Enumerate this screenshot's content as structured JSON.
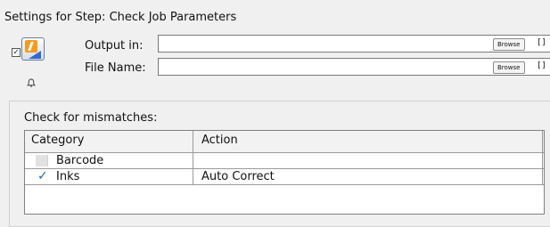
{
  "title": "Settings for Step: Check Job Parameters",
  "output_row": {
    "label": "Output in:",
    "value": "",
    "browse_label": "Browse",
    "bracket": "[]"
  },
  "file_row": {
    "label": "File Name:",
    "value": "",
    "browse_label": "Browse",
    "bracket": "[]"
  },
  "step_icon": {
    "checkbox_mark": "✓",
    "icon": "check-job-parameters-icon"
  },
  "mismatch": {
    "label": "Check for mismatches:",
    "columns": [
      "Category",
      "Action"
    ],
    "rows": [
      {
        "category": "Barcode",
        "action": "",
        "checked": false
      },
      {
        "category": "Inks",
        "action": "Auto Correct",
        "checked": true,
        "mark": "✓"
      }
    ]
  }
}
